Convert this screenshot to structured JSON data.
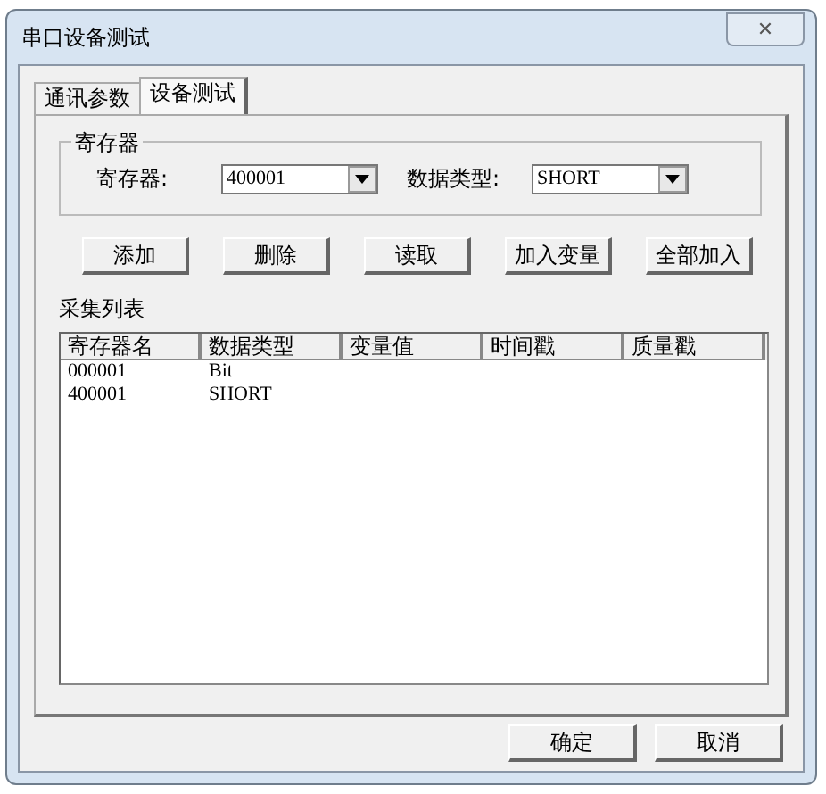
{
  "window": {
    "title": "串口设备测试",
    "close": "✕"
  },
  "tabs": [
    {
      "label": "通讯参数",
      "selected": false
    },
    {
      "label": "设备测试",
      "selected": true
    }
  ],
  "register_group": {
    "title": "寄存器",
    "fields": [
      {
        "label": "寄存器:",
        "value": "400001"
      },
      {
        "label": "数据类型:",
        "value": "SHORT"
      }
    ]
  },
  "buttons": [
    "添加",
    "删除",
    "读取",
    "加入变量",
    "全部加入"
  ],
  "list": {
    "title": "采集列表",
    "columns": [
      "寄存器名",
      "数据类型",
      "变量值",
      "时间戳",
      "质量戳"
    ],
    "rows": [
      [
        "000001",
        "Bit",
        "",
        "",
        ""
      ],
      [
        "400001",
        "SHORT",
        "",
        "",
        ""
      ]
    ]
  },
  "footer_buttons": [
    "确定",
    "取消"
  ]
}
